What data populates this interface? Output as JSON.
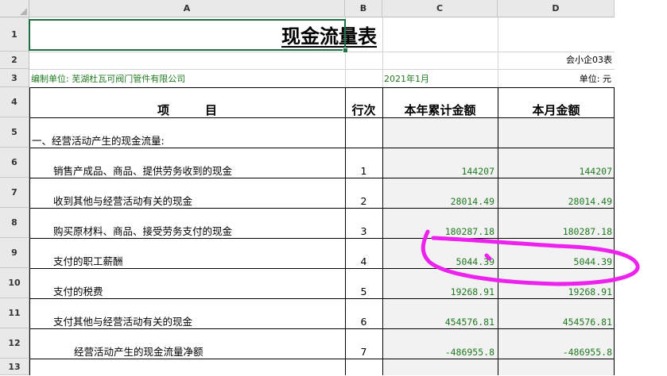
{
  "columns": [
    "A",
    "B",
    "C",
    "D"
  ],
  "rows": [
    "1",
    "2",
    "3",
    "4",
    "5",
    "6",
    "7",
    "8",
    "9",
    "10",
    "11",
    "12",
    "13"
  ],
  "sheet": {
    "title": "现金流量表",
    "form_code": "会小企03表",
    "company": "编制单位: 芜湖杜瓦可阀门管件有限公司",
    "period": "2021年1月",
    "unit": "单位: 元",
    "header": {
      "item": "项　　　目",
      "line": "行次",
      "ytd": "本年累计金额",
      "month": "本月金额"
    },
    "section": "一、经营活动产生的现金流量:",
    "items": [
      {
        "label": "销售产成品、商品、提供劳务收到的现金",
        "line": "1",
        "ytd": "144207",
        "month": "144207"
      },
      {
        "label": "收到其他与经营活动有关的现金",
        "line": "2",
        "ytd": "28014.49",
        "month": "28014.49"
      },
      {
        "label": "购买原材料、商品、接受劳务支付的现金",
        "line": "3",
        "ytd": "180287.18",
        "month": "180287.18"
      },
      {
        "label": "支付的职工薪酬",
        "line": "4",
        "ytd": "5044.39",
        "month": "5044.39"
      },
      {
        "label": "支付的税费",
        "line": "5",
        "ytd": "19268.91",
        "month": "19268.91"
      },
      {
        "label": "支付其他与经营活动有关的现金",
        "line": "6",
        "ytd": "454576.81",
        "month": "454576.81"
      },
      {
        "label": "经营活动产生的现金流量净额",
        "line": "7",
        "ytd": "-486955.8",
        "month": "-486955.8"
      }
    ]
  },
  "annotation_color": "#ee22ee"
}
